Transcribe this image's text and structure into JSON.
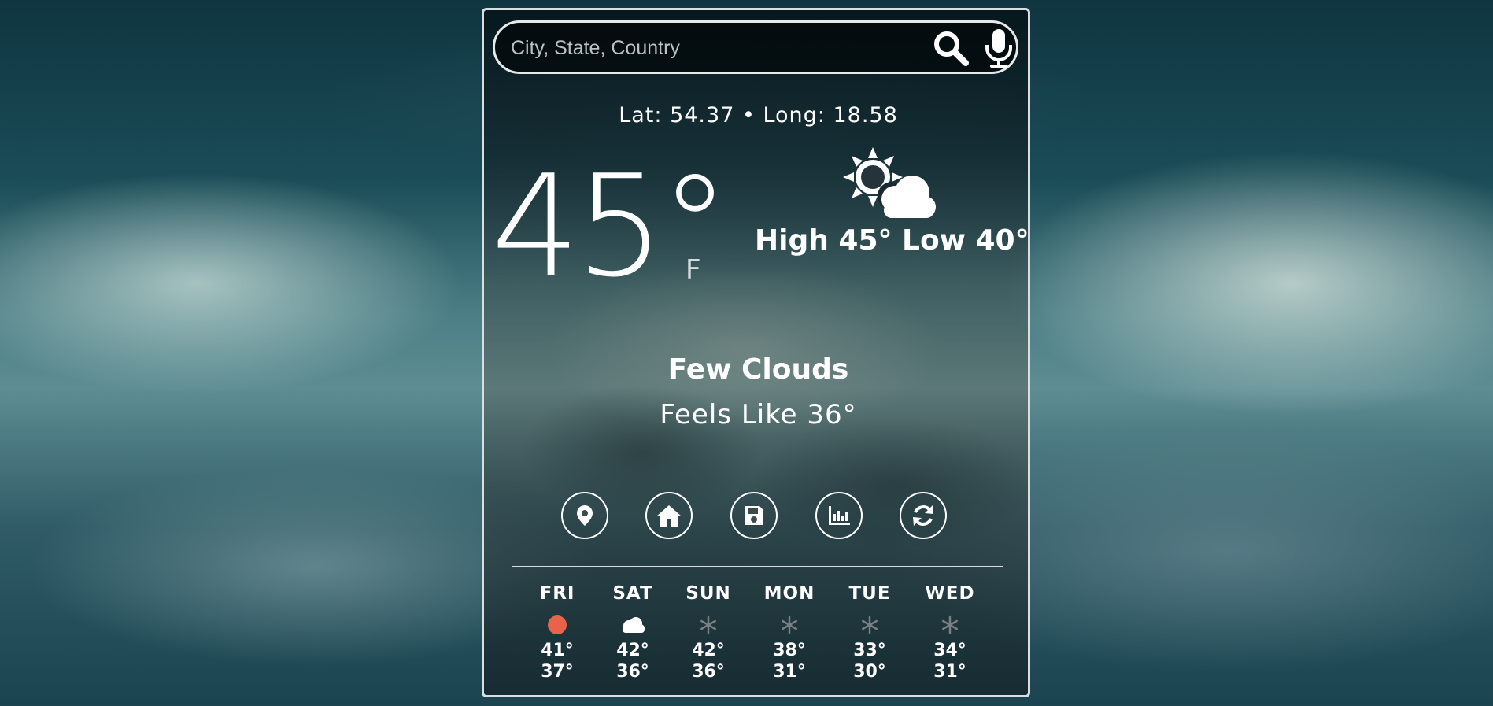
{
  "search": {
    "placeholder": "City, State, Country",
    "value": ""
  },
  "location": {
    "coords_text": "Lat: 54.37 • Long: 18.58"
  },
  "current": {
    "temperature": "45°",
    "unit": "F",
    "high_low": "High 45° Low 40°",
    "condition": "Few Clouds",
    "feels_like": "Feels Like 36°",
    "icon": "sun-behind-cloud-icon"
  },
  "actions": [
    {
      "icon": "map-marker-icon"
    },
    {
      "icon": "home-icon"
    },
    {
      "icon": "save-icon"
    },
    {
      "icon": "bar-chart-icon"
    },
    {
      "icon": "refresh-icon"
    }
  ],
  "forecast": [
    {
      "day": "FRI",
      "icon": "sun-icon",
      "high": "41°",
      "low": "37°"
    },
    {
      "day": "SAT",
      "icon": "cloud-icon",
      "high": "42°",
      "low": "36°"
    },
    {
      "day": "SUN",
      "icon": "snowflake-icon",
      "high": "42°",
      "low": "36°"
    },
    {
      "day": "MON",
      "icon": "snowflake-icon",
      "high": "38°",
      "low": "31°"
    },
    {
      "day": "TUE",
      "icon": "snowflake-icon",
      "high": "33°",
      "low": "30°"
    },
    {
      "day": "WED",
      "icon": "snowflake-icon",
      "high": "34°",
      "low": "31°"
    }
  ],
  "colors": {
    "sun": "#e8634a",
    "text": "#ffffff",
    "snow": "#7a7f82"
  }
}
